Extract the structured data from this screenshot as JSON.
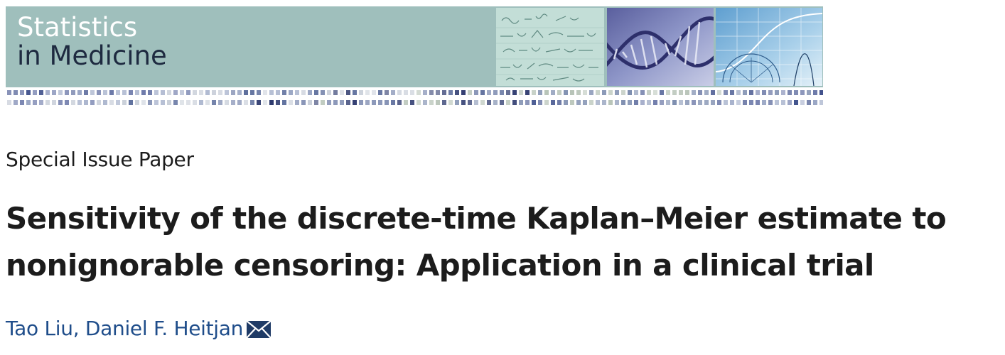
{
  "journal": {
    "title_line1": "Statistics",
    "title_line2": "in Medicine",
    "colors": {
      "banner_bg": "#9fbfbc",
      "title_light": "#ffffff",
      "title_dark": "#1e2a40"
    }
  },
  "article": {
    "type": "Special Issue Paper",
    "title": "Sensitivity of the discrete-time Kaplan–Meier estimate to nonignorable censoring: Application in a clinical trial",
    "authors": [
      {
        "name": "Tao Liu",
        "corresponding": false
      },
      {
        "name": "Daniel F. Heitjan",
        "corresponding": true
      }
    ],
    "author_separator": ", ",
    "corresponding_icon": "mail-icon",
    "colors": {
      "text": "#1c1c1c",
      "author_link": "#1f4d8a"
    }
  }
}
